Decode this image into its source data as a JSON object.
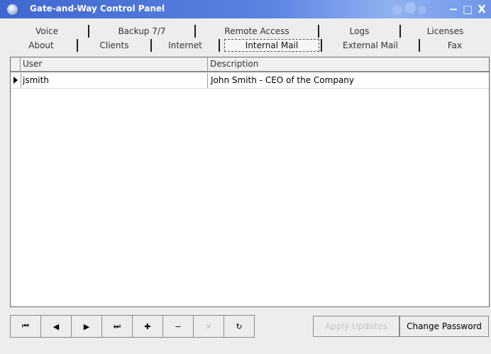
{
  "window": {
    "title": "Gate-and-Way Control Panel",
    "controls": {
      "minimize": "−",
      "maximize": "□",
      "close": "X"
    }
  },
  "tabs": {
    "row1": [
      "Voice",
      "Backup 7/7",
      "Remote Access",
      "Logs",
      "Licenses"
    ],
    "row2": [
      "About",
      "Clients",
      "Internet",
      "Internal Mail",
      "External Mail",
      "Fax"
    ],
    "active": "Internal Mail"
  },
  "grid": {
    "columns": [
      "User",
      "Description"
    ],
    "rows": [
      {
        "user": "jsmith",
        "description": "John Smith - CEO of the Company"
      }
    ]
  },
  "navigator": {
    "first": "⏮",
    "prior": "◀",
    "next": "▶",
    "last": "⏭",
    "insert": "✚",
    "delete": "−",
    "cancel": "✕",
    "refresh": "↻"
  },
  "buttons": {
    "apply_updates": "Apply Updates",
    "change_password": "Change Password"
  }
}
